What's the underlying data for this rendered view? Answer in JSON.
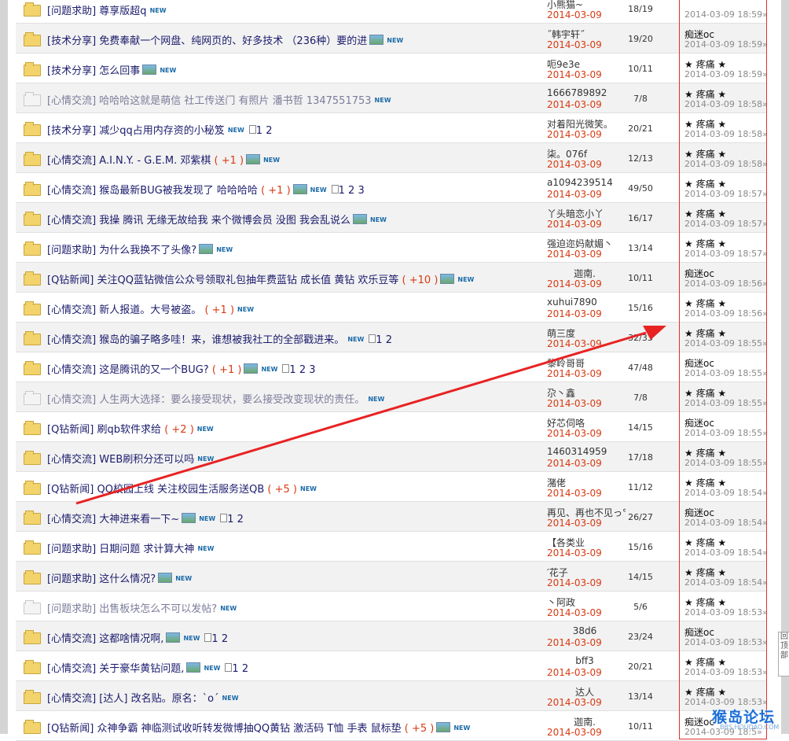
{
  "threads": [
    {
      "category": "[问题求助]",
      "subject": "尊享版超q",
      "plus": "",
      "image": false,
      "pages": "",
      "author": "小熊猫~",
      "author_center": false,
      "date": "2014-03-09",
      "count": "18/19",
      "last_user": "",
      "last_time": "2014-03-09 18:59»",
      "read": false
    },
    {
      "category": "[技术分享]",
      "subject": "免费奉献一个网盘、纯网页的、好多技术 （236种）要的进",
      "plus": "",
      "image": true,
      "pages": "",
      "author": "˝韩宇轩˝",
      "author_center": false,
      "date": "2014-03-09",
      "count": "19/20",
      "last_user": "痴迷oc",
      "last_time": "2014-03-09 18:59»",
      "read": false
    },
    {
      "category": "[技术分享]",
      "subject": "怎么回事",
      "plus": "",
      "image": true,
      "pages": "",
      "author": "呃9e3e",
      "author_center": false,
      "date": "2014-03-09",
      "count": "10/11",
      "last_user": "★ 疼痛 ★",
      "last_time": "2014-03-09 18:59»",
      "read": false
    },
    {
      "category": "[心情交流]",
      "subject": "哈哈哈这就是萌信 社工传送门 有照片 潘书哲 1347551753",
      "plus": "",
      "image": false,
      "pages": "",
      "author": "1666789892",
      "author_center": false,
      "date": "2014-03-09",
      "count": "7/8",
      "last_user": "★ 疼痛 ★",
      "last_time": "2014-03-09 18:58»",
      "read": true
    },
    {
      "category": "[技术分享]",
      "subject": "减少qq占用内存资的小秘笈",
      "plus": "",
      "image": false,
      "pages": "1 2",
      "author": "对着阳光微笑。",
      "author_center": false,
      "date": "2014-03-09",
      "count": "20/21",
      "last_user": "★ 疼痛 ★",
      "last_time": "2014-03-09 18:58»",
      "read": false
    },
    {
      "category": "[心情交流]",
      "subject": "A.I.N.Y. - G.E.M. 邓紫棋",
      "plus": "( +1 )",
      "image": true,
      "pages": "",
      "author": "柒。076f",
      "author_center": false,
      "date": "2014-03-09",
      "count": "12/13",
      "last_user": "★ 疼痛 ★",
      "last_time": "2014-03-09 18:58»",
      "read": false
    },
    {
      "category": "[心情交流]",
      "subject": "猴岛最新BUG被我发现了 哈哈哈哈",
      "plus": "( +1 )",
      "image": true,
      "pages": "1 2 3",
      "author": "a1094239514",
      "author_center": false,
      "date": "2014-03-09",
      "count": "49/50",
      "last_user": "★ 疼痛 ★",
      "last_time": "2014-03-09 18:57»",
      "read": false
    },
    {
      "category": "[心情交流]",
      "subject": "我操 腾讯 无缘无故给我 来个微博会员 没图 我会乱说么",
      "plus": "",
      "image": true,
      "pages": "",
      "author": "丫头暗恋小丫",
      "author_center": false,
      "date": "2014-03-09",
      "count": "16/17",
      "last_user": "★ 疼痛 ★",
      "last_time": "2014-03-09 18:57»",
      "read": false
    },
    {
      "category": "[问题求助]",
      "subject": "为什么我换不了头像?",
      "plus": "",
      "image": true,
      "pages": "",
      "author": "强迫迩妈献媚丶",
      "author_center": false,
      "date": "2014-03-09",
      "count": "13/14",
      "last_user": "★ 疼痛 ★",
      "last_time": "2014-03-09 18:57»",
      "read": false
    },
    {
      "category": "[Q钻新闻]",
      "subject": "关注QQ蓝钻微信公众号领取礼包抽年费蓝钻 成长值 黄钻 欢乐豆等",
      "plus": "( +10 )",
      "image": true,
      "pages": "",
      "author": "迦南.",
      "author_center": true,
      "date": "2014-03-09",
      "count": "10/11",
      "last_user": "痴迷oc",
      "last_time": "2014-03-09 18:56»",
      "read": false
    },
    {
      "category": "[心情交流]",
      "subject": "新人报道。大号被盗。",
      "plus": "( +1 )",
      "image": false,
      "pages": "",
      "author": "xuhui7890",
      "author_center": false,
      "date": "2014-03-09",
      "count": "15/16",
      "last_user": "★ 疼痛 ★",
      "last_time": "2014-03-09 18:56»",
      "read": false
    },
    {
      "category": "[心情交流]",
      "subject": "猴岛的骗子略多哇！来，谁想被我社工的全部戳进来。",
      "plus": "",
      "image": false,
      "pages": "1 2",
      "author": "萌三度",
      "author_center": false,
      "date": "2014-03-09",
      "count": "32/33",
      "last_user": "★ 疼痛 ★",
      "last_time": "2014-03-09 18:55»",
      "read": false
    },
    {
      "category": "[心情交流]",
      "subject": "这是腾讯的又一个BUG?",
      "plus": "( +1 )",
      "image": true,
      "pages": "1 2 3",
      "author": "黎岭哥哥",
      "author_center": false,
      "date": "2014-03-09",
      "count": "47/48",
      "last_user": "痴迷oc",
      "last_time": "2014-03-09 18:55»",
      "read": false
    },
    {
      "category": "[心情交流]",
      "subject": "人生两大选择：要么接受现状，要么接受改变现状的责任。",
      "plus": "",
      "image": false,
      "pages": "",
      "author": "尕丶鑫",
      "author_center": false,
      "date": "2014-03-09",
      "count": "7/8",
      "last_user": "★ 疼痛 ★",
      "last_time": "2014-03-09 18:55»",
      "read": true
    },
    {
      "category": "[Q钻新闻]",
      "subject": "刷qb软件求给",
      "plus": "( +2 )",
      "image": false,
      "pages": "",
      "author": "好芯伺咯",
      "author_center": false,
      "date": "2014-03-09",
      "count": "14/15",
      "last_user": "痴迷oc",
      "last_time": "2014-03-09 18:55»",
      "read": false
    },
    {
      "category": "[心情交流]",
      "subject": "WEB刷积分还可以吗",
      "plus": "",
      "image": false,
      "pages": "",
      "author": "1460314959",
      "author_center": false,
      "date": "2014-03-09",
      "count": "17/18",
      "last_user": "★ 疼痛 ★",
      "last_time": "2014-03-09 18:55»",
      "read": false
    },
    {
      "category": "[Q钻新闻]",
      "subject": "QQ校园上线 关注校园生活服务送QB",
      "plus": "( +5 )",
      "image": false,
      "pages": "",
      "author": "潴佬",
      "author_center": false,
      "date": "2014-03-09",
      "count": "11/12",
      "last_user": "★ 疼痛 ★",
      "last_time": "2014-03-09 18:54»",
      "read": false
    },
    {
      "category": "[心情交流]",
      "subject": "大神进来看一下~",
      "plus": "",
      "image": true,
      "pages": "1 2",
      "author": "再见、再也不见っ°",
      "author_center": false,
      "date": "2014-03-09",
      "count": "26/27",
      "last_user": "痴迷oc",
      "last_time": "2014-03-09 18:54»",
      "read": false
    },
    {
      "category": "[问题求助]",
      "subject": "日期问题 求计算大神",
      "plus": "",
      "image": false,
      "pages": "",
      "author": "【各类业",
      "author_center": false,
      "date": "2014-03-09",
      "count": "15/16",
      "last_user": "★ 疼痛 ★",
      "last_time": "2014-03-09 18:54»",
      "read": false
    },
    {
      "category": "[问题求助]",
      "subject": "这什么情况?",
      "plus": "",
      "image": true,
      "pages": "",
      "author": "′花子",
      "author_center": false,
      "date": "2014-03-09",
      "count": "14/15",
      "last_user": "★ 疼痛 ★",
      "last_time": "2014-03-09 18:54»",
      "read": false
    },
    {
      "category": "[问题求助]",
      "subject": "出售板块怎么不可以发帖?",
      "plus": "",
      "image": false,
      "pages": "",
      "author": "丶阿政",
      "author_center": false,
      "date": "2014-03-09",
      "count": "5/6",
      "last_user": "★ 疼痛 ★",
      "last_time": "2014-03-09 18:53»",
      "read": true
    },
    {
      "category": "[心情交流]",
      "subject": "这都啥情况啊,",
      "plus": "",
      "image": true,
      "pages": "1 2",
      "author": "38d6",
      "author_center": true,
      "date": "2014-03-09",
      "count": "23/24",
      "last_user": "痴迷oc",
      "last_time": "2014-03-09 18:53»",
      "read": false
    },
    {
      "category": "[心情交流]",
      "subject": "关于豪华黄钻问题,",
      "plus": "",
      "image": true,
      "pages": "1 2",
      "author": "bff3",
      "author_center": true,
      "date": "2014-03-09",
      "count": "20/21",
      "last_user": "★ 疼痛 ★",
      "last_time": "2014-03-09 18:53»",
      "read": false
    },
    {
      "category": "[心情交流]",
      "subject": "[达人]   改名贴。原名：ˋoˊ",
      "plus": "",
      "image": false,
      "pages": "",
      "author": "达人",
      "author_center": true,
      "date": "2014-03-09",
      "count": "13/14",
      "last_user": "★ 疼痛 ★",
      "last_time": "2014-03-09 18:53»",
      "read": false
    },
    {
      "category": "[Q钻新闻]",
      "subject": "众神争霸 神临测试收听转发微博抽QQ黄钻 激活码 T恤 手表 鼠标垫",
      "plus": "( +5 )",
      "image": true,
      "pages": "",
      "author": "迦南.",
      "author_center": true,
      "date": "2014-03-09",
      "count": "10/11",
      "last_user": "痴迷oc",
      "last_time": "2014-03-09 18:5»",
      "read": false
    }
  ],
  "new_label": "NEW",
  "back_top_chars": [
    "回",
    "顶",
    "部"
  ],
  "watermark": {
    "main": "猴岛论坛",
    "sub": "BBS.HOUDAO.COM"
  },
  "colors": {
    "accent_red": "#d83a12",
    "annotation_red": "#e03030",
    "link": "#1b1b6d"
  }
}
